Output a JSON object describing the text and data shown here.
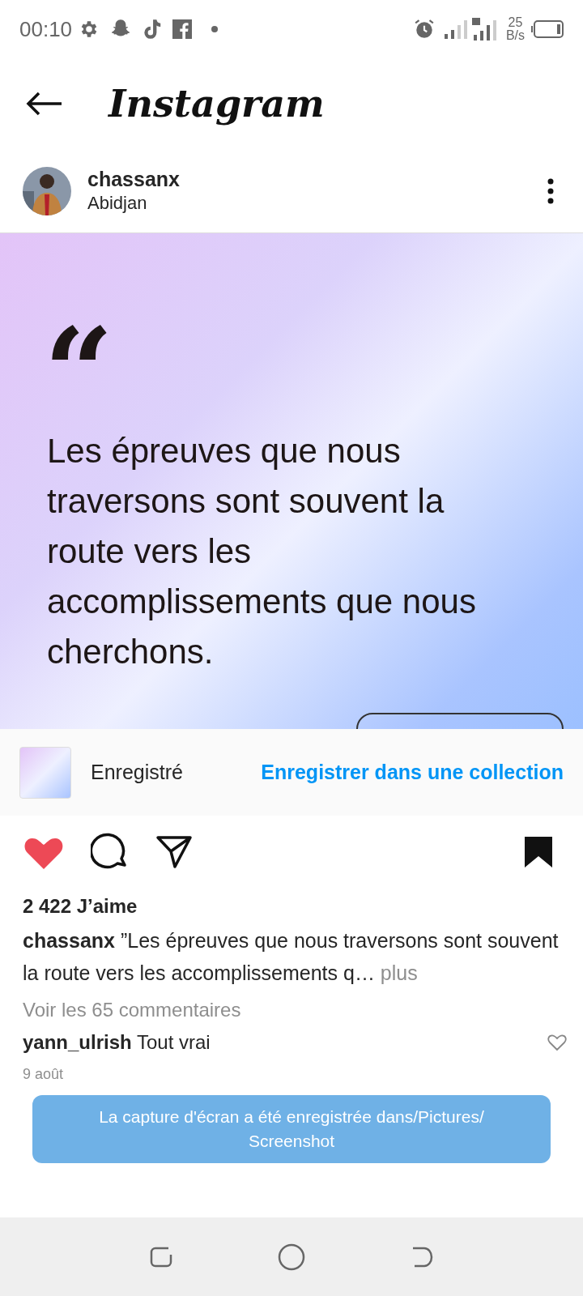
{
  "status_bar": {
    "time": "00:10",
    "net_speed_value": "25",
    "net_speed_unit": "B/s"
  },
  "app_bar": {
    "title": "Instagram"
  },
  "post": {
    "username": "chassanx",
    "location": "Abidjan",
    "image": {
      "quote_mark": "“",
      "quote": "Les épreuves que nous traversons sont souvent la route vers les accomplissements que nous cherchons."
    },
    "saved_banner": {
      "label": "Enregistré",
      "action": "Enregistrer dans une collection"
    },
    "liked": true,
    "saved": true,
    "likes": "2 422 J’aime",
    "caption": {
      "username": "chassanx",
      "text": "”Les épreuves que nous traversons sont souvent la route vers les accomplissements q…",
      "more": "plus"
    },
    "view_comments": "Voir les 65 commentaires",
    "comment": {
      "username": "yann_ulrish",
      "text": "Tout vrai"
    },
    "date": "9 août"
  },
  "toast": "La capture d'écran a été enregistrée dans/Pictures/ Screenshot"
}
